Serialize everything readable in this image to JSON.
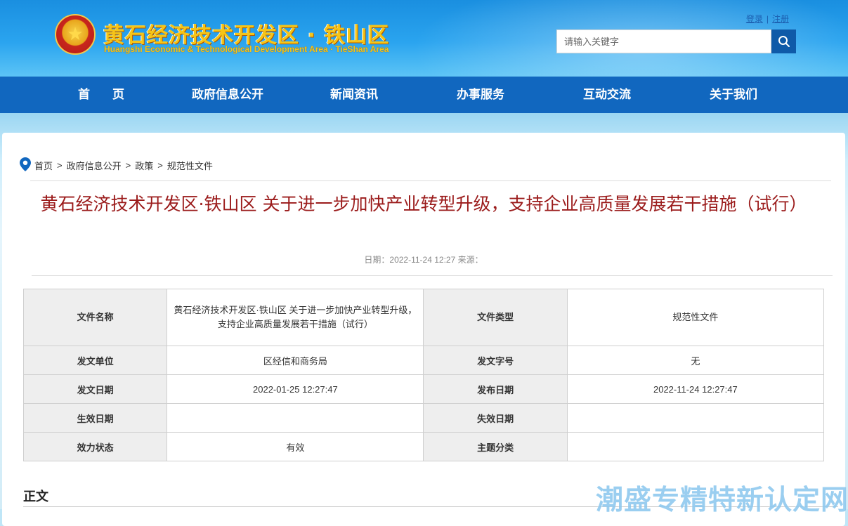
{
  "header": {
    "emblem_icon": "national-emblem-icon",
    "title": "黄石经济技术开发区 · 铁山区",
    "subtitle": "Huangshi Economic & Technological Development Area · TieShan Area",
    "login": "登录",
    "register": "注册",
    "search_placeholder": "请输入关键字",
    "search_icon": "search-icon"
  },
  "nav": {
    "items": [
      "首页",
      "政府信息公开",
      "新闻资讯",
      "办事服务",
      "互动交流",
      "关于我们"
    ]
  },
  "breadcrumb": {
    "icon": "location-pin-icon",
    "items": [
      "首页",
      "政府信息公开",
      "政策",
      "规范性文件"
    ]
  },
  "article": {
    "title": "黄石经济技术开发区·铁山区 关于进一步加快产业转型升级，支持企业高质量发展若干措施（试行）",
    "meta": "日期：2022-11-24 12:27 来源：",
    "section": "正文"
  },
  "info_table": {
    "rows": [
      [
        "文件名称",
        "黄石经济技术开发区·铁山区 关于进一步加快产业转型升级，支持企业高质量发展若干措施（试行）",
        "文件类型",
        "规范性文件"
      ],
      [
        "发文单位",
        "区经信和商务局",
        "发文字号",
        "无"
      ],
      [
        "发文日期",
        "2022-01-25 12:27:47",
        "发布日期",
        "2022-11-24 12:27:47"
      ],
      [
        "生效日期",
        "",
        "失效日期",
        ""
      ],
      [
        "效力状态",
        "有效",
        "主题分类",
        ""
      ]
    ]
  },
  "watermark": "潮盛专精特新认定网",
  "colors": {
    "nav_bg": "#1167bf",
    "title_red": "#9b1b1b",
    "header_blue": "#1a8fe0"
  }
}
